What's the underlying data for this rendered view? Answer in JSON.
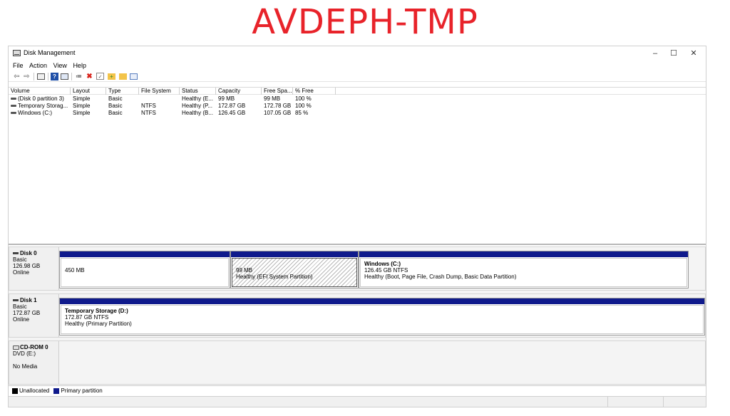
{
  "banner": {
    "text": "AVDEPH-TMP",
    "color": "#e8232a"
  },
  "window": {
    "title": "Disk Management",
    "minimize": "–",
    "maximize": "☐",
    "close": "✕"
  },
  "menu": [
    "File",
    "Action",
    "View",
    "Help"
  ],
  "toolbar_icons": [
    "back-icon",
    "forward-icon",
    "console-tree-icon",
    "help-icon",
    "properties-icon",
    "connect-disk-icon",
    "delete-icon",
    "checklist-icon",
    "new-volume-icon",
    "folder-icon",
    "list-view-icon"
  ],
  "volume_list": {
    "columns": [
      "Volume",
      "Layout",
      "Type",
      "File System",
      "Status",
      "Capacity",
      "Free Spa...",
      "% Free"
    ],
    "rows": [
      [
        "(Disk 0 partition 3)",
        "Simple",
        "Basic",
        "",
        "Healthy (E...",
        "99 MB",
        "99 MB",
        "100 %"
      ],
      [
        "Temporary Storag...",
        "Simple",
        "Basic",
        "NTFS",
        "Healthy (P...",
        "172.87 GB",
        "172.78 GB",
        "100 %"
      ],
      [
        "Windows (C:)",
        "Simple",
        "Basic",
        "NTFS",
        "Healthy (B...",
        "126.45 GB",
        "107.05 GB",
        "85 %"
      ]
    ]
  },
  "disks": {
    "disk0": {
      "name": "Disk 0",
      "type": "Basic",
      "size": "126.98 GB",
      "status": "Online",
      "partitions": [
        {
          "title": "",
          "line1": "450 MB",
          "line2": ""
        },
        {
          "title": "",
          "line1": "99 MB",
          "line2": "Healthy (EFI System Partition)"
        },
        {
          "title": "Windows  (C:)",
          "line1": "126.45 GB NTFS",
          "line2": "Healthy (Boot, Page File, Crash Dump, Basic Data Partition)"
        }
      ]
    },
    "disk1": {
      "name": "Disk 1",
      "type": "Basic",
      "size": "172.87 GB",
      "status": "Online",
      "partitions": [
        {
          "title": "Temporary Storage  (D:)",
          "line1": "172.87 GB NTFS",
          "line2": "Healthy (Primary Partition)"
        }
      ]
    },
    "cdrom0": {
      "name": "CD-ROM 0",
      "type": "DVD (E:)",
      "status": "No Media"
    }
  },
  "legend": {
    "unallocated": "Unallocated",
    "unallocated_color": "#000000",
    "primary": "Primary partition",
    "primary_color": "#0f1a8c"
  }
}
